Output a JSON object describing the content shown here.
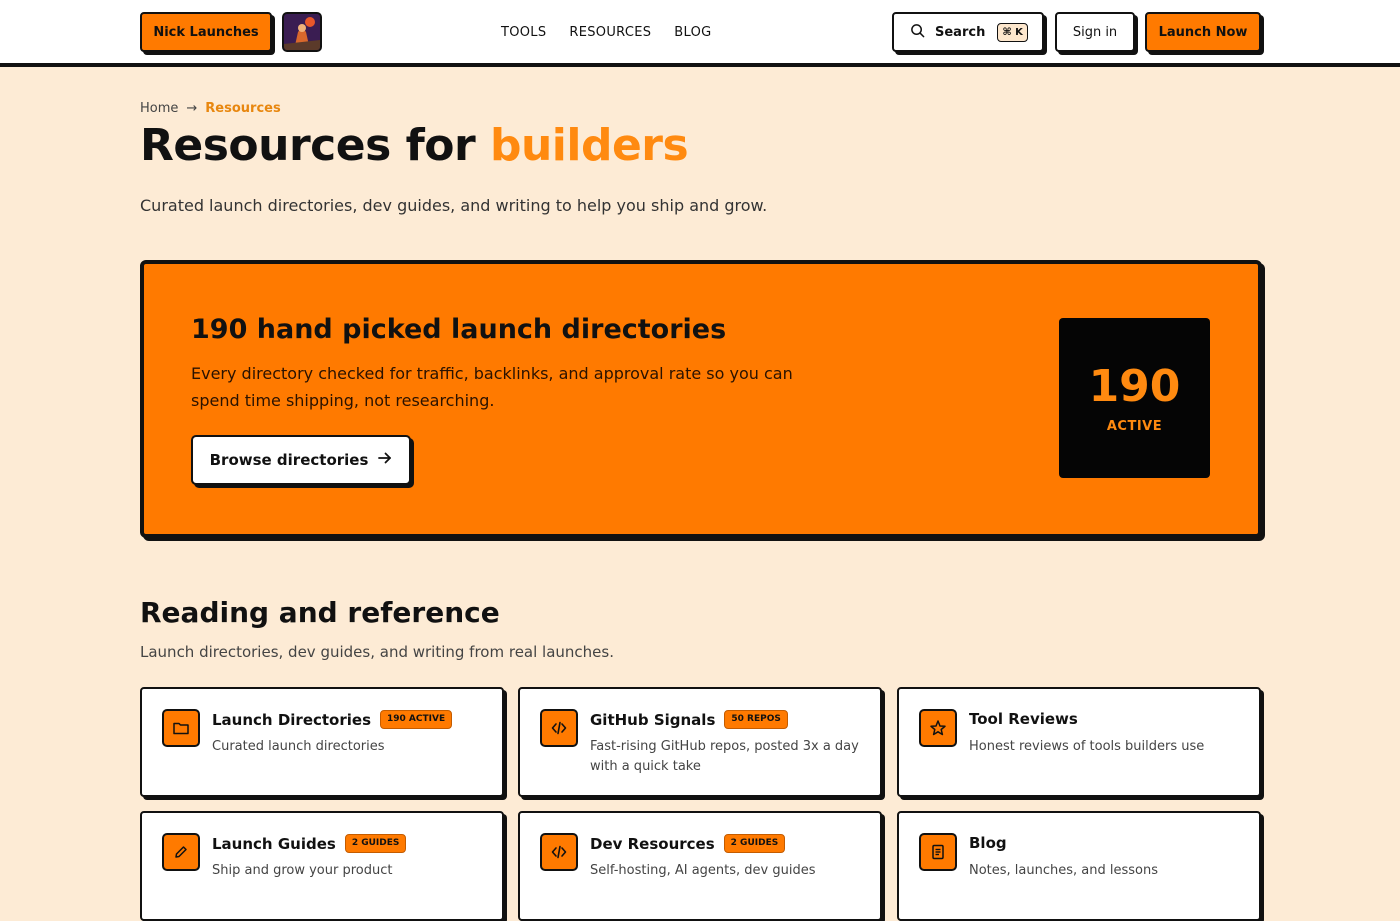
{
  "header": {
    "brand_label": "Nick Launches",
    "nav": [
      "TOOLS",
      "RESOURCES",
      "BLOG"
    ],
    "search_label": "Search",
    "search_shortcut": "⌘ K",
    "signin_label": "Sign in",
    "launch_label": "Launch Now"
  },
  "breadcrumb": {
    "home": "Home",
    "separator": "→",
    "current": "Resources"
  },
  "hero": {
    "title_main": "Resources for ",
    "title_accent": "builders",
    "subtitle": "Curated launch directories, dev guides, and writing to help you ship and grow."
  },
  "promo": {
    "title": "190 hand picked launch directories",
    "description": "Every directory checked for traffic, backlinks, and approval rate so you can spend time shipping, not researching.",
    "button_label": "Browse directories",
    "stat_value": "190",
    "stat_label": "ACTIVE"
  },
  "section": {
    "title": "Reading and reference",
    "subtitle": "Launch directories, dev guides, and writing from real launches."
  },
  "cards": [
    {
      "icon": "folder-icon",
      "title": "Launch Directories",
      "badge": "190 ACTIVE",
      "description": "Curated launch directories"
    },
    {
      "icon": "code-icon",
      "title": "GitHub Signals",
      "badge": "50 REPOS",
      "description": "Fast-rising GitHub repos, posted 3x a day with a quick take"
    },
    {
      "icon": "star-icon",
      "title": "Tool Reviews",
      "badge": "",
      "description": "Honest reviews of tools builders use"
    },
    {
      "icon": "pencil-icon",
      "title": "Launch Guides",
      "badge": "2 GUIDES",
      "description": "Ship and grow your product"
    },
    {
      "icon": "code-icon",
      "title": "Dev Resources",
      "badge": "2 GUIDES",
      "description": "Self-hosting, AI agents, dev guides"
    },
    {
      "icon": "document-icon",
      "title": "Blog",
      "badge": "",
      "description": "Notes, launches, and lessons"
    }
  ],
  "colors": {
    "accent": "#ff7a00",
    "background": "#fdebd5",
    "ink": "#111111"
  }
}
